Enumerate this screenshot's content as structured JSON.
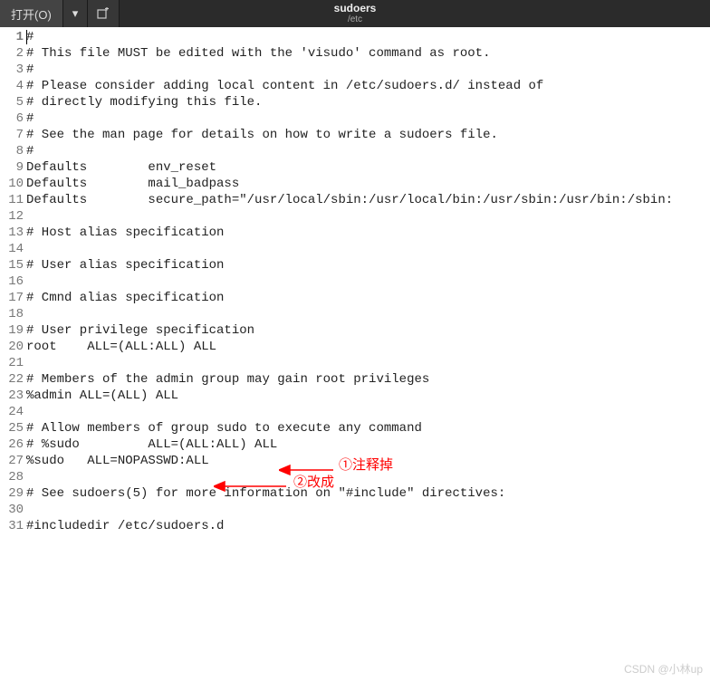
{
  "titlebar": {
    "open_label": "打开(O)",
    "dropdown_icon": "▾",
    "new_tab_icon": "new-tab",
    "title": "sudoers",
    "subtitle": "/etc"
  },
  "lines": [
    {
      "n": 1,
      "text": "#",
      "bold": true
    },
    {
      "n": 2,
      "text": "# This file MUST be edited with the 'visudo' command as root."
    },
    {
      "n": 3,
      "text": "#"
    },
    {
      "n": 4,
      "text": "# Please consider adding local content in /etc/sudoers.d/ instead of"
    },
    {
      "n": 5,
      "text": "# directly modifying this file."
    },
    {
      "n": 6,
      "text": "#"
    },
    {
      "n": 7,
      "text": "# See the man page for details on how to write a sudoers file."
    },
    {
      "n": 8,
      "text": "#"
    },
    {
      "n": 9,
      "text": "Defaults        env_reset"
    },
    {
      "n": 10,
      "text": "Defaults        mail_badpass"
    },
    {
      "n": 11,
      "text": "Defaults        secure_path=\"/usr/local/sbin:/usr/local/bin:/usr/sbin:/usr/bin:/sbin:"
    },
    {
      "n": 12,
      "text": ""
    },
    {
      "n": 13,
      "text": "# Host alias specification"
    },
    {
      "n": 14,
      "text": ""
    },
    {
      "n": 15,
      "text": "# User alias specification"
    },
    {
      "n": 16,
      "text": ""
    },
    {
      "n": 17,
      "text": "# Cmnd alias specification"
    },
    {
      "n": 18,
      "text": ""
    },
    {
      "n": 19,
      "text": "# User privilege specification"
    },
    {
      "n": 20,
      "text": "root    ALL=(ALL:ALL) ALL"
    },
    {
      "n": 21,
      "text": ""
    },
    {
      "n": 22,
      "text": "# Members of the admin group may gain root privileges"
    },
    {
      "n": 23,
      "text": "%admin ALL=(ALL) ALL"
    },
    {
      "n": 24,
      "text": ""
    },
    {
      "n": 25,
      "text": "# Allow members of group sudo to execute any command"
    },
    {
      "n": 26,
      "text": "# %sudo         ALL=(ALL:ALL) ALL"
    },
    {
      "n": 27,
      "text": "%sudo   ALL=NOPASSWD:ALL"
    },
    {
      "n": 28,
      "text": ""
    },
    {
      "n": 29,
      "text": "# See sudoers(5) for more information on \"#include\" directives:"
    },
    {
      "n": 30,
      "text": ""
    },
    {
      "n": 31,
      "text": "#includedir /etc/sudoers.d"
    }
  ],
  "annotations": {
    "a1": "①注释掉",
    "a2": "②改成"
  },
  "watermark": "CSDN @小林up"
}
